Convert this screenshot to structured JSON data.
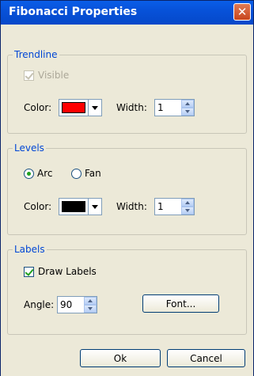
{
  "window": {
    "title": "Fibonacci Properties",
    "close_symbol": "✕"
  },
  "trendline": {
    "title": "Trendline",
    "visible_label": "Visible",
    "visible_checked": true,
    "color_label": "Color:",
    "color_value": "#ff0000",
    "width_label": "Width:",
    "width_value": "1"
  },
  "levels": {
    "title": "Levels",
    "arc_label": "Arc",
    "fan_label": "Fan",
    "selected": "Arc",
    "color_label": "Color:",
    "color_value": "#000000",
    "width_label": "Width:",
    "width_value": "1"
  },
  "labels": {
    "title": "Labels",
    "draw_labels_label": "Draw Labels",
    "draw_labels_checked": true,
    "angle_label": "Angle:",
    "angle_value": "90",
    "font_button_label": "Font..."
  },
  "footer": {
    "ok_label": "Ok",
    "cancel_label": "Cancel"
  }
}
